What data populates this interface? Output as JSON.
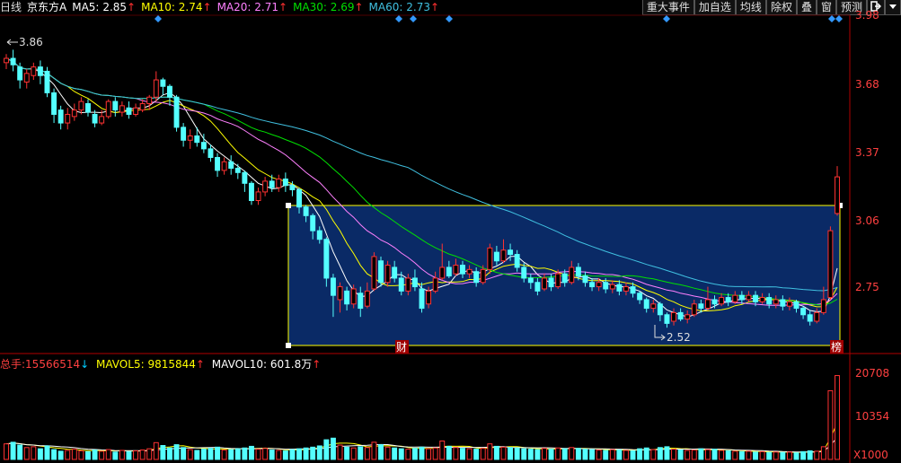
{
  "header": {
    "period": "日线",
    "stock_name": "京东方A",
    "ma5_label": "MA5:",
    "ma5_value": "2.85",
    "ma10_label": "MA10:",
    "ma10_value": "2.74",
    "ma20_label": "MA20:",
    "ma20_value": "2.71",
    "ma30_label": "MA30:",
    "ma30_value": "2.69",
    "ma60_label": "MA60:",
    "ma60_value": "2.73",
    "up_arrow": "↑",
    "down_arrow": "↓"
  },
  "toolbar": [
    "重大事件",
    "加自选",
    "均线",
    "除权",
    "叠",
    "窗",
    "预测"
  ],
  "toolbar_icons": [
    "exit-icon",
    "dropdown-icon"
  ],
  "volume_header": {
    "total_label": "总手:",
    "total_value": "15566514",
    "mavol5_label": "MAVOL5:",
    "mavol5_value": "9815844",
    "mavol10_label": "MAVOL10:",
    "mavol10_value": "601.8万"
  },
  "colors": {
    "up": "#ff3232",
    "down": "#54ffff",
    "ma5": "#ffffff",
    "ma10": "#ffff00",
    "ma20": "#ff80ff",
    "ma30": "#00e000",
    "ma60": "#40c0e0",
    "selection_fill": "#0a2a66",
    "selection_border": "#ffff00",
    "axis": "#b00000",
    "price_label": "#ff4040"
  },
  "chart_data": {
    "type": "candlestick",
    "title": "京东方A 日线",
    "price_axis_ticks": [
      "3.98",
      "3.68",
      "3.37",
      "3.06",
      "2.75"
    ],
    "price_range": [
      2.45,
      4.02
    ],
    "volume_axis_ticks": [
      "20708",
      "10354",
      "X1000"
    ],
    "volume_range": [
      0,
      21500
    ],
    "annotations": {
      "high": "3.86",
      "low": "2.52",
      "marker_finance": "财",
      "marker_list": "榜"
    },
    "candles": [
      [
        3.8,
        3.82,
        3.84,
        3.77
      ],
      [
        3.82,
        3.79,
        3.86,
        3.76
      ],
      [
        3.78,
        3.72,
        3.8,
        3.68
      ],
      [
        3.71,
        3.75,
        3.77,
        3.68
      ],
      [
        3.74,
        3.78,
        3.8,
        3.72
      ],
      [
        3.78,
        3.74,
        3.81,
        3.7
      ],
      [
        3.76,
        3.66,
        3.78,
        3.64
      ],
      [
        3.66,
        3.56,
        3.68,
        3.52
      ],
      [
        3.58,
        3.52,
        3.6,
        3.49
      ],
      [
        3.52,
        3.56,
        3.59,
        3.49
      ],
      [
        3.55,
        3.58,
        3.61,
        3.53
      ],
      [
        3.58,
        3.62,
        3.64,
        3.56
      ],
      [
        3.61,
        3.57,
        3.63,
        3.55
      ],
      [
        3.56,
        3.52,
        3.58,
        3.5
      ],
      [
        3.52,
        3.55,
        3.58,
        3.51
      ],
      [
        3.55,
        3.62,
        3.63,
        3.54
      ],
      [
        3.62,
        3.58,
        3.64,
        3.55
      ],
      [
        3.57,
        3.6,
        3.62,
        3.55
      ],
      [
        3.59,
        3.56,
        3.62,
        3.54
      ],
      [
        3.56,
        3.59,
        3.61,
        3.55
      ],
      [
        3.58,
        3.61,
        3.63,
        3.57
      ],
      [
        3.61,
        3.64,
        3.65,
        3.58
      ],
      [
        3.64,
        3.72,
        3.76,
        3.62
      ],
      [
        3.72,
        3.69,
        3.73,
        3.65
      ],
      [
        3.69,
        3.64,
        3.7,
        3.6
      ],
      [
        3.64,
        3.5,
        3.65,
        3.48
      ],
      [
        3.5,
        3.44,
        3.52,
        3.41
      ],
      [
        3.44,
        3.46,
        3.49,
        3.4
      ],
      [
        3.46,
        3.43,
        3.5,
        3.41
      ],
      [
        3.43,
        3.4,
        3.47,
        3.38
      ],
      [
        3.4,
        3.36,
        3.42,
        3.34
      ],
      [
        3.36,
        3.3,
        3.38,
        3.27
      ],
      [
        3.3,
        3.34,
        3.36,
        3.28
      ],
      [
        3.34,
        3.31,
        3.37,
        3.28
      ],
      [
        3.31,
        3.29,
        3.33,
        3.26
      ],
      [
        3.29,
        3.24,
        3.3,
        3.2
      ],
      [
        3.24,
        3.16,
        3.25,
        3.14
      ],
      [
        3.16,
        3.2,
        3.22,
        3.14
      ],
      [
        3.2,
        3.25,
        3.27,
        3.18
      ],
      [
        3.25,
        3.22,
        3.28,
        3.2
      ],
      [
        3.22,
        3.26,
        3.28,
        3.2
      ],
      [
        3.26,
        3.23,
        3.29,
        3.2
      ],
      [
        3.23,
        3.21,
        3.25,
        3.18
      ],
      [
        3.21,
        3.13,
        3.22,
        3.1
      ],
      [
        3.13,
        3.09,
        3.14,
        3.06
      ],
      [
        3.09,
        3.02,
        3.1,
        2.98
      ],
      [
        3.02,
        2.98,
        3.04,
        2.96
      ],
      [
        2.98,
        2.8,
        2.99,
        2.76
      ],
      [
        2.8,
        2.72,
        2.82,
        2.62
      ],
      [
        2.7,
        2.76,
        2.78,
        2.64
      ],
      [
        2.74,
        2.68,
        2.76,
        2.65
      ],
      [
        2.68,
        2.75,
        2.77,
        2.66
      ],
      [
        2.73,
        2.66,
        2.76,
        2.62
      ],
      [
        2.67,
        2.74,
        2.78,
        2.66
      ],
      [
        2.75,
        2.9,
        2.92,
        2.74
      ],
      [
        2.88,
        2.78,
        2.9,
        2.76
      ],
      [
        2.78,
        2.86,
        2.88,
        2.76
      ],
      [
        2.85,
        2.8,
        2.88,
        2.78
      ],
      [
        2.8,
        2.74,
        2.83,
        2.72
      ],
      [
        2.74,
        2.8,
        2.82,
        2.72
      ],
      [
        2.8,
        2.76,
        2.84,
        2.74
      ],
      [
        2.75,
        2.66,
        2.78,
        2.64
      ],
      [
        2.68,
        2.74,
        2.76,
        2.66
      ],
      [
        2.74,
        2.8,
        2.83,
        2.73
      ],
      [
        2.8,
        2.85,
        2.96,
        2.79
      ],
      [
        2.85,
        2.81,
        2.88,
        2.8
      ],
      [
        2.82,
        2.86,
        2.89,
        2.81
      ],
      [
        2.86,
        2.82,
        2.88,
        2.8
      ],
      [
        2.82,
        2.84,
        2.86,
        2.8
      ],
      [
        2.83,
        2.78,
        2.85,
        2.76
      ],
      [
        2.78,
        2.84,
        2.86,
        2.77
      ],
      [
        2.84,
        2.94,
        2.96,
        2.82
      ],
      [
        2.92,
        2.88,
        2.95,
        2.86
      ],
      [
        2.88,
        2.93,
        2.98,
        2.87
      ],
      [
        2.93,
        2.91,
        2.96,
        2.88
      ],
      [
        2.91,
        2.85,
        2.93,
        2.83
      ],
      [
        2.85,
        2.8,
        2.87,
        2.78
      ],
      [
        2.8,
        2.78,
        2.82,
        2.75
      ],
      [
        2.78,
        2.74,
        2.8,
        2.72
      ],
      [
        2.75,
        2.8,
        2.82,
        2.74
      ],
      [
        2.8,
        2.76,
        2.82,
        2.74
      ],
      [
        2.76,
        2.82,
        2.84,
        2.75
      ],
      [
        2.82,
        2.78,
        2.84,
        2.76
      ],
      [
        2.78,
        2.85,
        2.88,
        2.77
      ],
      [
        2.85,
        2.81,
        2.87,
        2.79
      ],
      [
        2.81,
        2.78,
        2.83,
        2.76
      ],
      [
        2.78,
        2.76,
        2.8,
        2.74
      ],
      [
        2.76,
        2.78,
        2.8,
        2.74
      ],
      [
        2.78,
        2.75,
        2.8,
        2.73
      ],
      [
        2.75,
        2.77,
        2.79,
        2.73
      ],
      [
        2.77,
        2.74,
        2.79,
        2.72
      ],
      [
        2.74,
        2.76,
        2.78,
        2.72
      ],
      [
        2.76,
        2.73,
        2.78,
        2.71
      ],
      [
        2.73,
        2.7,
        2.74,
        2.68
      ],
      [
        2.7,
        2.66,
        2.71,
        2.64
      ],
      [
        2.66,
        2.68,
        2.7,
        2.64
      ],
      [
        2.68,
        2.63,
        2.69,
        2.6
      ],
      [
        2.63,
        2.59,
        2.64,
        2.57
      ],
      [
        2.6,
        2.64,
        2.66,
        2.58
      ],
      [
        2.64,
        2.61,
        2.66,
        2.6
      ],
      [
        2.61,
        2.63,
        2.65,
        2.59
      ],
      [
        2.63,
        2.68,
        2.7,
        2.62
      ],
      [
        2.68,
        2.66,
        2.7,
        2.64
      ],
      [
        2.66,
        2.7,
        2.76,
        2.65
      ],
      [
        2.7,
        2.68,
        2.72,
        2.66
      ],
      [
        2.68,
        2.71,
        2.73,
        2.67
      ],
      [
        2.71,
        2.69,
        2.73,
        2.67
      ],
      [
        2.69,
        2.72,
        2.74,
        2.68
      ],
      [
        2.72,
        2.7,
        2.74,
        2.68
      ],
      [
        2.7,
        2.72,
        2.74,
        2.69
      ],
      [
        2.72,
        2.69,
        2.74,
        2.67
      ],
      [
        2.69,
        2.71,
        2.73,
        2.68
      ],
      [
        2.71,
        2.68,
        2.73,
        2.66
      ],
      [
        2.68,
        2.7,
        2.72,
        2.66
      ],
      [
        2.7,
        2.67,
        2.72,
        2.65
      ],
      [
        2.67,
        2.69,
        2.71,
        2.65
      ],
      [
        2.69,
        2.66,
        2.7,
        2.64
      ],
      [
        2.66,
        2.63,
        2.67,
        2.61
      ],
      [
        2.63,
        2.6,
        2.65,
        2.58
      ],
      [
        2.6,
        2.64,
        2.66,
        2.59
      ],
      [
        2.64,
        2.7,
        2.76,
        2.63
      ],
      [
        2.71,
        3.02,
        3.04,
        2.7
      ],
      [
        3.1,
        3.27,
        3.32,
        3.09
      ]
    ],
    "volumes": [
      3800,
      4200,
      3500,
      2900,
      3100,
      2600,
      3300,
      2400,
      2000,
      2200,
      2500,
      2100,
      1900,
      2300,
      2000,
      2400,
      1800,
      2200,
      1900,
      2100,
      2300,
      2600,
      4100,
      3400,
      2800,
      3600,
      2900,
      2400,
      2200,
      2500,
      2700,
      3000,
      2300,
      2400,
      2600,
      2800,
      3200,
      2500,
      2700,
      2300,
      2200,
      2100,
      2400,
      2600,
      2800,
      3000,
      3300,
      4800,
      5200,
      3500,
      3000,
      2800,
      3100,
      2900,
      4200,
      3600,
      3000,
      2800,
      2600,
      2500,
      2700,
      3000,
      2600,
      2800,
      4500,
      3200,
      2900,
      2700,
      2600,
      2500,
      2700,
      3800,
      3200,
      3000,
      2900,
      2800,
      2600,
      2500,
      2400,
      2700,
      2500,
      2800,
      2600,
      2900,
      2700,
      2500,
      2400,
      2300,
      2200,
      2400,
      2300,
      2200,
      2100,
      2600,
      2800,
      2400,
      2900,
      3100,
      2500,
      2300,
      2200,
      2300,
      2600,
      2400,
      2500,
      2200,
      2100,
      2000,
      1900,
      2000,
      1800,
      1900,
      1700,
      1800,
      1700,
      1800,
      1600,
      1900,
      2100,
      2000,
      3100,
      16800,
      20500
    ]
  }
}
